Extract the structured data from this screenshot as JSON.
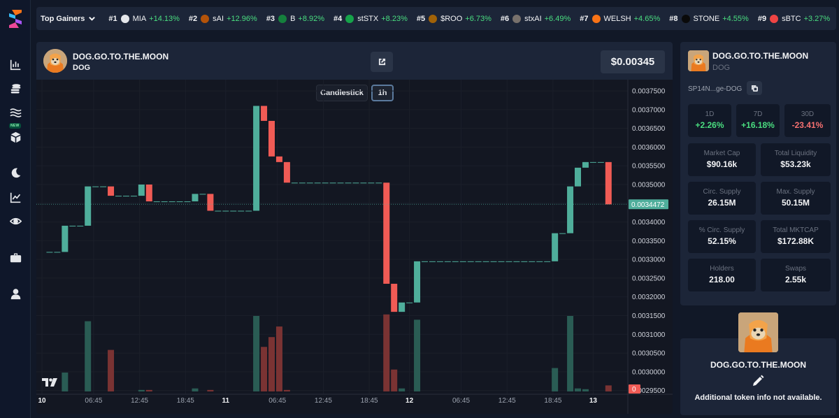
{
  "ticker": {
    "title": "Top Gainers",
    "items": [
      {
        "rank": "#1",
        "symbol": "MIA",
        "change": "+14.13%",
        "logo_color": "#e5e7eb"
      },
      {
        "rank": "#2",
        "symbol": "sAI",
        "change": "+12.96%",
        "logo_color": "#b45309"
      },
      {
        "rank": "#3",
        "symbol": "B",
        "change": "+8.92%",
        "logo_color": "#15803d"
      },
      {
        "rank": "#4",
        "symbol": "stSTX",
        "change": "+8.23%",
        "logo_color": "#16a34a"
      },
      {
        "rank": "#5",
        "symbol": "$ROO",
        "change": "+6.73%",
        "logo_color": "#a16207"
      },
      {
        "rank": "#6",
        "symbol": "stxAI",
        "change": "+6.49%",
        "logo_color": "#78716c"
      },
      {
        "rank": "#7",
        "symbol": "WELSH",
        "change": "+4.65%",
        "logo_color": "#f97316"
      },
      {
        "rank": "#8",
        "symbol": "STONE",
        "change": "+4.55%",
        "logo_color": "#0a0a0a"
      },
      {
        "rank": "#9",
        "symbol": "sBTC",
        "change": "+3.27%",
        "logo_color": "#ef4444"
      }
    ]
  },
  "token": {
    "name": "DOG.GO.TO.THE.MOON",
    "symbol": "DOG",
    "price": "$0.00345",
    "address": "SP14N...ge-DOG"
  },
  "chart_controls": {
    "type_label": "Candlestick",
    "interval_label": "1h"
  },
  "stats": {
    "changes": [
      {
        "label": "1D",
        "value": "+2.26%",
        "dir": "pos"
      },
      {
        "label": "7D",
        "value": "+16.18%",
        "dir": "pos"
      },
      {
        "label": "30D",
        "value": "-23.41%",
        "dir": "neg"
      }
    ],
    "market_cap": {
      "label": "Market Cap",
      "value": "$90.16k"
    },
    "total_liquidity": {
      "label": "Total Liquidity",
      "value": "$53.23k"
    },
    "circ_supply": {
      "label": "Circ. Supply",
      "value": "26.15M"
    },
    "max_supply": {
      "label": "Max. Supply",
      "value": "50.15M"
    },
    "pct_circ": {
      "label": "% Circ. Supply",
      "value": "52.15%"
    },
    "total_mktcap": {
      "label": "Total MKTCAP",
      "value": "$172.88K"
    },
    "holders": {
      "label": "Holders",
      "value": "218.00"
    },
    "swaps": {
      "label": "Swaps",
      "value": "2.55k"
    }
  },
  "about": {
    "name": "DOG.GO.TO.THE.MOON",
    "text": "Additional token info not available."
  },
  "sidebar": {
    "new_badge": "NEW"
  },
  "chart_data": {
    "type": "candlestick",
    "y_ticks": [
      "0.0037500",
      "0.0037000",
      "0.0036500",
      "0.0036000",
      "0.0035500",
      "0.0035000",
      "0.0034500",
      "0.0034000",
      "0.0033500",
      "0.0033000",
      "0.0032500",
      "0.0032000",
      "0.0031500",
      "0.0031000",
      "0.0030500",
      "0.0030000",
      "0.0029500"
    ],
    "ylim": [
      0.00294,
      0.00378
    ],
    "x_ticks": [
      {
        "label": "10",
        "t": 0,
        "bold": true
      },
      {
        "label": "06:45",
        "t": 6.75
      },
      {
        "label": "12:45",
        "t": 12.75
      },
      {
        "label": "18:45",
        "t": 18.75
      },
      {
        "label": "11",
        "t": 24,
        "bold": true
      },
      {
        "label": "06:45",
        "t": 30.75
      },
      {
        "label": "12:45",
        "t": 36.75
      },
      {
        "label": "18:45",
        "t": 42.75
      },
      {
        "label": "12",
        "t": 48,
        "bold": true
      },
      {
        "label": "06:45",
        "t": 54.75
      },
      {
        "label": "12:45",
        "t": 60.75
      },
      {
        "label": "18:45",
        "t": 66.75
      },
      {
        "label": "13",
        "t": 72,
        "bold": true
      }
    ],
    "current_price_label": "0.0034472",
    "current_price": 0.0034472,
    "volume_label": "0",
    "candles": [
      {
        "t": 1,
        "o": 0.00332,
        "c": 0.00332,
        "v": 0
      },
      {
        "t": 2,
        "o": 0.00332,
        "c": 0.00332,
        "v": 0
      },
      {
        "t": 3,
        "o": 0.00332,
        "c": 0.00339,
        "v": 0.25
      },
      {
        "t": 4,
        "o": 0.00339,
        "c": 0.00339,
        "v": 0
      },
      {
        "t": 5,
        "o": 0.00339,
        "c": 0.00339,
        "v": 0
      },
      {
        "t": 6,
        "o": 0.00339,
        "c": 0.003495,
        "v": 0.93
      },
      {
        "t": 7,
        "o": 0.003495,
        "c": 0.003495,
        "v": 0
      },
      {
        "t": 8,
        "o": 0.003495,
        "c": 0.003495,
        "v": 0
      },
      {
        "t": 9,
        "o": 0.003495,
        "c": 0.00347,
        "v": 0.55
      },
      {
        "t": 10,
        "o": 0.00347,
        "c": 0.00347,
        "v": 0
      },
      {
        "t": 11,
        "o": 0.00347,
        "c": 0.00347,
        "v": 0
      },
      {
        "t": 12,
        "o": 0.00347,
        "c": 0.00347,
        "v": 0
      },
      {
        "t": 13,
        "o": 0.00347,
        "c": 0.0035,
        "v": 0.02
      },
      {
        "t": 14,
        "o": 0.0035,
        "c": 0.003455,
        "v": 0.02
      },
      {
        "t": 15,
        "o": 0.003455,
        "c": 0.003455,
        "v": 0
      },
      {
        "t": 16,
        "o": 0.003455,
        "c": 0.003455,
        "v": 0
      },
      {
        "t": 17,
        "o": 0.003455,
        "c": 0.003455,
        "v": 0
      },
      {
        "t": 18,
        "o": 0.003455,
        "c": 0.003455,
        "v": 0
      },
      {
        "t": 19,
        "o": 0.003455,
        "c": 0.003455,
        "v": 0
      },
      {
        "t": 20,
        "o": 0.003455,
        "c": 0.003475,
        "v": 0.04
      },
      {
        "t": 21,
        "o": 0.003475,
        "c": 0.003475,
        "v": 0
      },
      {
        "t": 22,
        "o": 0.003475,
        "c": 0.00343,
        "v": 0.02
      },
      {
        "t": 23,
        "o": 0.00343,
        "c": 0.00343,
        "v": 0
      },
      {
        "t": 24,
        "o": 0.00343,
        "c": 0.00343,
        "v": 0
      },
      {
        "t": 25,
        "o": 0.00343,
        "c": 0.00343,
        "v": 0
      },
      {
        "t": 26,
        "o": 0.00343,
        "c": 0.00343,
        "v": 0
      },
      {
        "t": 27,
        "o": 0.00343,
        "c": 0.00343,
        "v": 0
      },
      {
        "t": 28,
        "o": 0.00343,
        "c": 0.00371,
        "v": 1.0
      },
      {
        "t": 29,
        "o": 0.00371,
        "c": 0.00367,
        "v": 0.59
      },
      {
        "t": 30,
        "o": 0.00367,
        "c": 0.003575,
        "v": 0.72
      },
      {
        "t": 31,
        "o": 0.003575,
        "c": 0.00356,
        "v": 0.86
      },
      {
        "t": 32,
        "o": 0.00356,
        "c": 0.003505,
        "v": 0.02
      },
      {
        "t": 33,
        "o": 0.003505,
        "c": 0.003505,
        "v": 0
      },
      {
        "t": 34,
        "o": 0.003505,
        "c": 0.003505,
        "v": 0
      },
      {
        "t": 35,
        "o": 0.003505,
        "c": 0.003505,
        "v": 0
      },
      {
        "t": 36,
        "o": 0.003505,
        "c": 0.003505,
        "v": 0
      },
      {
        "t": 37,
        "o": 0.003505,
        "c": 0.003505,
        "v": 0
      },
      {
        "t": 38,
        "o": 0.003505,
        "c": 0.003505,
        "v": 0
      },
      {
        "t": 39,
        "o": 0.003505,
        "c": 0.003505,
        "v": 0
      },
      {
        "t": 40,
        "o": 0.003505,
        "c": 0.003505,
        "v": 0
      },
      {
        "t": 41,
        "o": 0.003505,
        "c": 0.003505,
        "v": 0
      },
      {
        "t": 42,
        "o": 0.003505,
        "c": 0.003505,
        "v": 0
      },
      {
        "t": 43,
        "o": 0.003505,
        "c": 0.003505,
        "v": 0
      },
      {
        "t": 44,
        "o": 0.003505,
        "c": 0.003505,
        "v": 0
      },
      {
        "t": 45,
        "o": 0.003505,
        "c": 0.003235,
        "v": 1.02
      },
      {
        "t": 46,
        "o": 0.003235,
        "c": 0.00316,
        "v": 0.29
      },
      {
        "t": 47,
        "o": 0.00316,
        "c": 0.003185,
        "v": 0.04
      },
      {
        "t": 48,
        "o": 0.003185,
        "c": 0.003185,
        "v": 0
      },
      {
        "t": 49,
        "o": 0.003185,
        "c": 0.003295,
        "v": 0.95
      },
      {
        "t": 50,
        "o": 0.003295,
        "c": 0.003295,
        "v": 0
      },
      {
        "t": 51,
        "o": 0.003295,
        "c": 0.003295,
        "v": 0
      },
      {
        "t": 52,
        "o": 0.003295,
        "c": 0.003295,
        "v": 0
      },
      {
        "t": 53,
        "o": 0.003295,
        "c": 0.003295,
        "v": 0
      },
      {
        "t": 54,
        "o": 0.003295,
        "c": 0.003295,
        "v": 0
      },
      {
        "t": 55,
        "o": 0.003295,
        "c": 0.003295,
        "v": 0
      },
      {
        "t": 56,
        "o": 0.003295,
        "c": 0.003295,
        "v": 0
      },
      {
        "t": 57,
        "o": 0.003295,
        "c": 0.003295,
        "v": 0
      },
      {
        "t": 58,
        "o": 0.003295,
        "c": 0.003295,
        "v": 0
      },
      {
        "t": 59,
        "o": 0.003295,
        "c": 0.003295,
        "v": 0
      },
      {
        "t": 60,
        "o": 0.003295,
        "c": 0.003295,
        "v": 0
      },
      {
        "t": 61,
        "o": 0.003295,
        "c": 0.003295,
        "v": 0
      },
      {
        "t": 62,
        "o": 0.003295,
        "c": 0.003295,
        "v": 0
      },
      {
        "t": 63,
        "o": 0.003295,
        "c": 0.003295,
        "v": 0
      },
      {
        "t": 64,
        "o": 0.003295,
        "c": 0.003295,
        "v": 0
      },
      {
        "t": 65,
        "o": 0.003295,
        "c": 0.003295,
        "v": 0
      },
      {
        "t": 66,
        "o": 0.003295,
        "c": 0.003295,
        "v": 0
      },
      {
        "t": 67,
        "o": 0.003295,
        "c": 0.00337,
        "v": 0.31
      },
      {
        "t": 68,
        "o": 0.00337,
        "c": 0.00337,
        "v": 0
      },
      {
        "t": 69,
        "o": 0.00337,
        "c": 0.003495,
        "v": 1.0
      },
      {
        "t": 70,
        "o": 0.003495,
        "c": 0.003545,
        "v": 0.04
      },
      {
        "t": 71,
        "o": 0.003545,
        "c": 0.00356,
        "v": 0.03
      },
      {
        "t": 72,
        "o": 0.00356,
        "c": 0.00356,
        "v": 0
      },
      {
        "t": 73,
        "o": 0.00356,
        "c": 0.00356,
        "v": 0
      },
      {
        "t": 74,
        "o": 0.00356,
        "c": 0.003447,
        "v": 0.08
      }
    ]
  }
}
